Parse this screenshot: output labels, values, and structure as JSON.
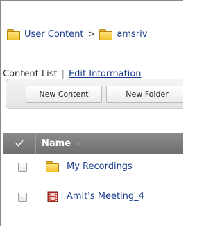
{
  "breadcrumb": {
    "root_label": "User Content",
    "separator": ">",
    "current_label": "amsriv"
  },
  "tabs": {
    "active_label": "Content List",
    "separator": "|",
    "edit_label": "Edit Information"
  },
  "toolbar": {
    "new_content_label": "New Content",
    "new_folder_label": "New Folder"
  },
  "table": {
    "name_header": "Name",
    "sort_arrow": "›",
    "rows": [
      {
        "label": "My Recordings",
        "icon": "folder-icon",
        "checked": false
      },
      {
        "label": "Amit's Meeting_4",
        "icon": "meeting-recording-icon",
        "checked": false
      }
    ]
  },
  "colors": {
    "link": "#1a3c8c",
    "header_bg": "#7d7d7d",
    "folder": "#f1c232",
    "recording_icon": "#c0392b"
  }
}
